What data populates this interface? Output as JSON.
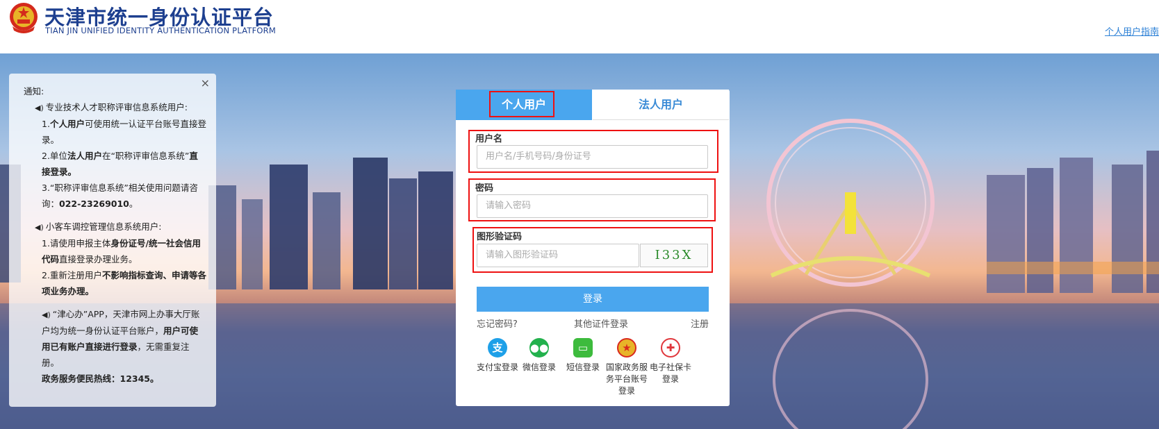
{
  "header": {
    "title_cn": "天津市统一身份认证平台",
    "title_en": "TIAN JIN UNIFIED IDENTITY AUTHENTICATION PLATFORM",
    "guide_link": "个人用户指南"
  },
  "notice": {
    "close_label": "×",
    "title": "通知:",
    "section1_heading": "专业技术人才职称评审信息系统用户:",
    "s1_p1_prefix": "1.",
    "s1_p1_bold": "个人用户",
    "s1_p1_text": "可使用统一认证平台账号直接登录。",
    "s1_p2_prefix": "2.单位",
    "s1_p2_bold": "法人用户",
    "s1_p2_text": "在“职称评审信息系统”",
    "s1_p2_bold2": "直接登录。",
    "s1_p3_text": "3.“职称评审信息系统”相关使用问题请咨询：",
    "s1_p3_bold": "022-23269010",
    "s1_p3_end": "。",
    "section2_heading": "小客车调控管理信息系统用户:",
    "s2_p1_text": "1.请使用申报主体",
    "s2_p1_bold": "身份证号/统一社会信用代码",
    "s2_p1_end": "直接登录办理业务。",
    "s2_p2_text": "2.重新注册用户",
    "s2_p2_bold": "不影响指标查询、申请等各项业务办理。",
    "section3_text": "“津心办”APP，天津市网上办事大厅账户均为统一身份认证平台账户，",
    "section3_bold": "用户可使用已有账户直接进行登录",
    "section3_end": "，无需重复注册。",
    "hotline": "政务服务便民热线：12345。"
  },
  "login": {
    "tabs": [
      {
        "label": "个人用户",
        "active": true
      },
      {
        "label": "法人用户",
        "active": false
      }
    ],
    "username_label": "用户名",
    "username_placeholder": "用户名/手机号码/身份证号",
    "password_label": "密码",
    "password_placeholder": "请输入密码",
    "captcha_label": "图形验证码",
    "captcha_placeholder": "请输入图形验证码",
    "captcha_text": "I33X",
    "login_button": "登录",
    "forgot_password": "忘记密码?",
    "other_cert_login": "其他证件登录",
    "register": "注册",
    "alt_logins": [
      {
        "label": "支付宝登录",
        "icon": "alipay-icon",
        "color": "#1ea0e8"
      },
      {
        "label": "微信登录",
        "icon": "wechat-icon",
        "color": "#23b14d"
      },
      {
        "label": "短信登录",
        "icon": "sms-icon",
        "color": "#3dbb3d"
      },
      {
        "label": "国家政务服务平台账号登录",
        "icon": "national-emblem-icon",
        "color": "#d92a1e"
      },
      {
        "label": "电子社保卡登录",
        "icon": "social-security-card-icon",
        "color": "#e0373c"
      }
    ]
  },
  "colors": {
    "accent": "#4aa6ee",
    "title": "#1d3f8f",
    "highlight": "#e11111"
  }
}
